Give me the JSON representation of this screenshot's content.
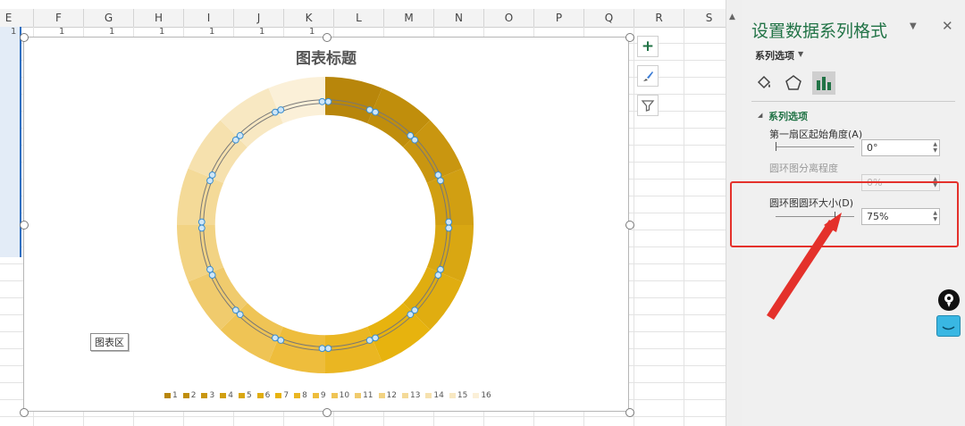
{
  "sheet": {
    "columns": [
      "E",
      "F",
      "G",
      "H",
      "I",
      "J",
      "K",
      "L",
      "M",
      "N",
      "O",
      "P",
      "Q",
      "R",
      "S"
    ],
    "row1_values": [
      "1",
      "1",
      "1",
      "1",
      "1",
      "1",
      "1"
    ]
  },
  "chart": {
    "title": "图表标题",
    "tooltip": "图表区",
    "side_buttons": [
      "plus-icon",
      "brush-icon",
      "filter-icon"
    ]
  },
  "chart_data": {
    "type": "pie",
    "subtype": "doughnut",
    "categories": [
      "1",
      "2",
      "3",
      "4",
      "5",
      "6",
      "7",
      "8",
      "9",
      "10",
      "11",
      "12",
      "13",
      "14",
      "15",
      "16"
    ],
    "values": [
      1,
      1,
      1,
      1,
      1,
      1,
      1,
      1,
      1,
      1,
      1,
      1,
      1,
      1,
      1,
      1
    ],
    "colors": [
      "#b8860b",
      "#c08e0c",
      "#c99610",
      "#d19f12",
      "#d9a712",
      "#e0ad10",
      "#e7b30e",
      "#eab622",
      "#eebd3c",
      "#efc455",
      "#f0cb6d",
      "#f2d383",
      "#f4da98",
      "#f6e1ae",
      "#f8e8c2",
      "#fbf0d8"
    ],
    "hole_size_percent": 75,
    "legend_position": "bottom"
  },
  "pane": {
    "title": "设置数据系列格式",
    "subtitle": "系列选项",
    "icons": [
      "paint-bucket-icon",
      "pentagon-icon",
      "bar-chart-icon"
    ],
    "section": "系列选项",
    "first_angle_label": "第一扇区起始角度(A)",
    "first_angle_value": "0°",
    "explosion_label": "圆环图分离程度",
    "explosion_value": "0%",
    "hole_label": "圆环图圆环大小(D)",
    "hole_value": "75%",
    "hole_slider_level": 0.75
  }
}
